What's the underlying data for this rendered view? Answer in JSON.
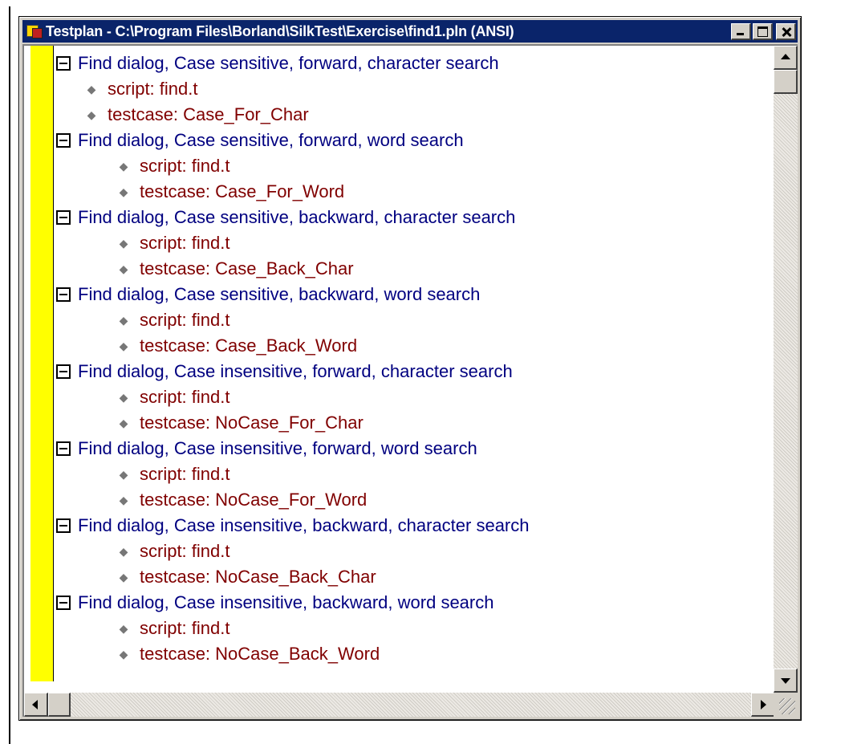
{
  "window": {
    "title": "Testplan - C:\\Program Files\\Borland\\SilkTest\\Exercise\\find1.pln (ANSI)"
  },
  "tree": [
    {
      "label": "Find dialog, Case sensitive, forward, character search",
      "script": "script: find.t",
      "testcase": "testcase: Case_For_Char"
    },
    {
      "label": "Find dialog, Case sensitive, forward, word search",
      "script": "script: find.t",
      "testcase": "testcase: Case_For_Word"
    },
    {
      "label": "Find dialog, Case sensitive, backward, character search",
      "script": "script: find.t",
      "testcase": "testcase: Case_Back_Char"
    },
    {
      "label": "Find dialog, Case sensitive, backward, word search",
      "script": "script: find.t",
      "testcase": "testcase: Case_Back_Word"
    },
    {
      "label": "Find dialog, Case insensitive, forward, character search",
      "script": "script: find.t",
      "testcase": "testcase: NoCase_For_Char"
    },
    {
      "label": "Find dialog, Case insensitive, forward, word search",
      "script": "script: find.t",
      "testcase": "testcase: NoCase_For_Word"
    },
    {
      "label": "Find dialog, Case insensitive, backward, character search",
      "script": "script: find.t",
      "testcase": "testcase: NoCase_Back_Char"
    },
    {
      "label": "Find dialog, Case insensitive, backward, word search",
      "script": "script: find.t",
      "testcase": "testcase: NoCase_Back_Word"
    }
  ],
  "icons": {
    "app": "silktest-testplan-icon",
    "expanded": "collapse-minus-icon",
    "leaf": "diamond-bullet-icon"
  },
  "colors": {
    "titlebar": "#0a246a",
    "group_text": "#000080",
    "leaf_text": "#800000",
    "margin": "#ffff00"
  }
}
